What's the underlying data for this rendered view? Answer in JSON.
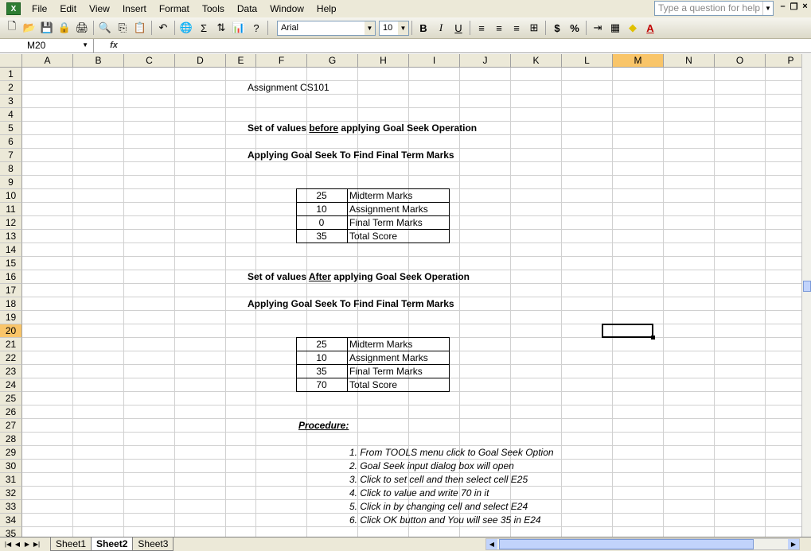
{
  "menu": {
    "items": [
      "File",
      "Edit",
      "View",
      "Insert",
      "Format",
      "Tools",
      "Data",
      "Window",
      "Help"
    ],
    "help_placeholder": "Type a question for help"
  },
  "toolbar": {
    "font_name": "Arial",
    "font_size": "10",
    "bold": "B",
    "italic": "I",
    "underline": "U",
    "currency": "$",
    "percent": "%",
    "sum": "Σ"
  },
  "formula_bar": {
    "name_box": "M20",
    "fx_label": "fx",
    "value": ""
  },
  "grid": {
    "columns": [
      "A",
      "B",
      "C",
      "D",
      "E",
      "F",
      "G",
      "H",
      "I",
      "J",
      "K",
      "L",
      "M",
      "N",
      "O",
      "P"
    ],
    "rows": [
      "1",
      "2",
      "3",
      "4",
      "5",
      "6",
      "7",
      "8",
      "9",
      "10",
      "11",
      "12",
      "13",
      "14",
      "15",
      "16",
      "17",
      "18",
      "19",
      "20",
      "21",
      "22",
      "23",
      "24",
      "25",
      "26",
      "27",
      "28",
      "29",
      "30",
      "31",
      "32",
      "33",
      "34",
      "35"
    ],
    "active_column": "M",
    "active_row": "20"
  },
  "content": {
    "title": "Assignment CS101",
    "heading_before": {
      "pre": "Set of values ",
      "emph": "before",
      "post": " applying Goal Seek Operation"
    },
    "goal_seek_1": "Applying Goal Seek To Find Final Term Marks",
    "table_before": [
      {
        "value": "25",
        "label": "Midterm Marks"
      },
      {
        "value": "10",
        "label": "Assignment Marks"
      },
      {
        "value": "0",
        "label": "Final Term Marks"
      },
      {
        "value": "35",
        "label": "Total Score"
      }
    ],
    "heading_after": {
      "pre": "Set of values ",
      "emph": "After",
      "post": " applying Goal Seek Operation"
    },
    "goal_seek_2": "Applying Goal Seek To Find Final Term Marks",
    "table_after": [
      {
        "value": "25",
        "label": "Midterm Marks"
      },
      {
        "value": "10",
        "label": "Assignment Marks"
      },
      {
        "value": "35",
        "label": "Final Term Marks"
      },
      {
        "value": "70",
        "label": "Total Score"
      }
    ],
    "procedure_label": "Procedure:",
    "procedure_steps": [
      "1. From TOOLS menu click to Goal Seek Option",
      "2. Goal Seek input dialog box will open",
      "3. Click to set cell and then select cell  E25",
      "4. Click to value and write 70 in it",
      "5. Click in by changing cell and select E24",
      "6. Click OK button and You will see 35 in E24"
    ]
  },
  "sheets": {
    "tabs": [
      "Sheet1",
      "Sheet2",
      "Sheet3"
    ],
    "active": "Sheet2"
  }
}
